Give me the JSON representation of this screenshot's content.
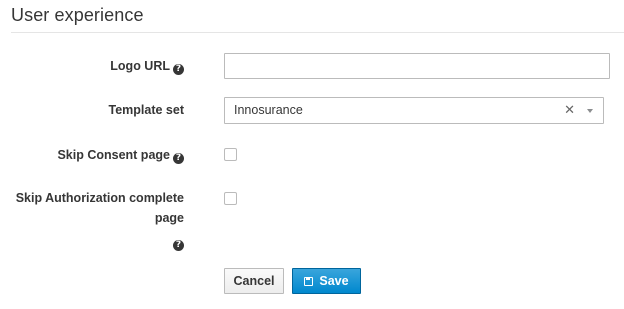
{
  "section": {
    "title": "User experience"
  },
  "fields": {
    "logo_url": {
      "label": "Logo URL",
      "value": "",
      "help_icon": "question-circle-icon"
    },
    "template_set": {
      "label": "Template set",
      "selected": "Innosurance",
      "clear_glyph": "✕",
      "caret_icon": "caret-down-icon"
    },
    "skip_consent": {
      "label": "Skip Consent page",
      "checked": false,
      "help_icon": "question-circle-icon"
    },
    "skip_authorization_complete": {
      "label_line1": "Skip Authorization complete",
      "label_line2": "page",
      "checked": false,
      "help_icon": "question-circle-icon"
    }
  },
  "actions": {
    "cancel_label": "Cancel",
    "save_label": "Save",
    "save_icon": "save-icon"
  },
  "colors": {
    "primary": "#0088ce",
    "primary_border": "#00659c",
    "text": "#363636",
    "border": "#bbbbbb"
  }
}
